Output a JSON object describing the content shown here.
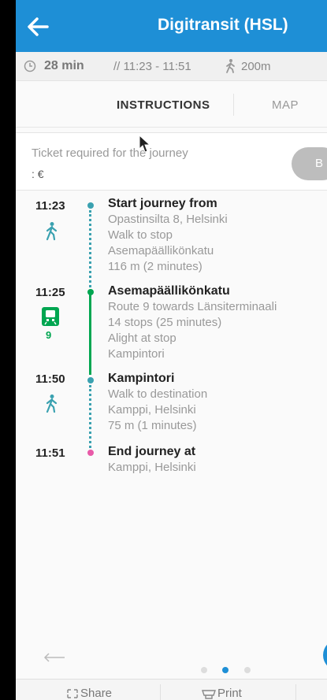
{
  "header": {
    "title": "Digitransit (HSL)"
  },
  "summary": {
    "duration": "28 min",
    "times": "// 11:23 - 11:51",
    "walk_distance": "200m"
  },
  "tabs": [
    {
      "label": "INSTRUCTIONS"
    },
    {
      "label": "MAP"
    }
  ],
  "ticket": {
    "label": "Ticket required for the journey",
    "price": ": €",
    "buy_label": "B"
  },
  "legs": [
    {
      "time": "11:23",
      "title": "Start journey from",
      "lines": [
        "Opastinsilta 8, Helsinki",
        "Walk to stop",
        "Asemapäällikönkatu",
        "116 m (2 minutes)"
      ]
    },
    {
      "time": "11:25",
      "title": "Asemapäällikönkatu",
      "route_number": "9",
      "lines": [
        "Route 9 towards Länsiterminaali",
        "14 stops (25 minutes)",
        "Alight at stop",
        "Kampintori"
      ]
    },
    {
      "time": "11:50",
      "title": "Kampintori",
      "lines": [
        "Walk to destination",
        "Kamppi, Helsinki",
        "75 m (1 minutes)"
      ]
    },
    {
      "time": "11:51",
      "title": "End journey at",
      "lines": [
        "Kamppi, Helsinki"
      ]
    }
  ],
  "bottom": {
    "share_label": "Share",
    "print_label": "Print"
  },
  "colors": {
    "primary": "#1e8fd6",
    "tram": "#00a651",
    "walk": "#3aa1b0",
    "end": "#e85aa8"
  },
  "icons": [
    "back-arrow-icon",
    "clock-icon",
    "walk-icon",
    "tram-icon",
    "share-icon",
    "print-icon",
    "cursor-icon"
  ]
}
